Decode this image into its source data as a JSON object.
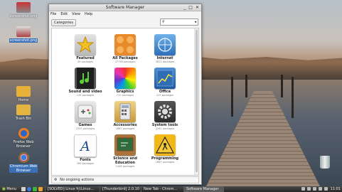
{
  "window": {
    "title": "Software Manager",
    "controls": [
      "_",
      "□",
      "✕"
    ]
  },
  "menubar": [
    "File",
    "Edit",
    "View",
    "Help"
  ],
  "toolbar": {
    "categories_label": "Categories",
    "search_placeholder": ""
  },
  "categories": [
    {
      "name": "Featured",
      "count": "45 packages",
      "icon": "star-icon"
    },
    {
      "name": "All Packages",
      "count": "47738 packages",
      "icon": "all-packages-icon"
    },
    {
      "name": "Internet",
      "count": "3811 packages",
      "icon": "globe-icon"
    },
    {
      "name": "Sound and video",
      "count": "135 packages",
      "icon": "music-note-icon"
    },
    {
      "name": "Graphics",
      "count": "713 packages",
      "icon": "color-wheel-icon"
    },
    {
      "name": "Office",
      "count": "229 packages",
      "icon": "chart-icon"
    },
    {
      "name": "Games",
      "count": "2253 packages",
      "icon": "gamepad-icon"
    },
    {
      "name": "Accessories",
      "count": "1863 packages",
      "icon": "calculator-icon"
    },
    {
      "name": "System tools",
      "count": "2161 packages",
      "icon": "gear-icon"
    },
    {
      "name": "Fonts",
      "count": "289 packages",
      "icon": "font-icon"
    },
    {
      "name": "Science and Education",
      "count": "1446 packages",
      "icon": "chalkboard-icon"
    },
    {
      "name": "Programming",
      "count": "1883 packages",
      "icon": "construction-icon"
    }
  ],
  "status": {
    "text": "No ongoing actions"
  },
  "desktop_icons": [
    {
      "label": "screenshot.png"
    },
    {
      "label": "screenshot.png",
      "selected": true
    },
    {
      "label": "Home"
    },
    {
      "label": "Trash Bin"
    },
    {
      "label": "Firefox Web Browser"
    },
    {
      "label": "Chromium Web Browser",
      "selected": true
    }
  ],
  "taskbar": {
    "menu_label": "Menu",
    "tasks": [
      "[SOLVED] Linux Mi...",
      "Linux...",
      "[Thunderbird] 2.0.10",
      "New Tab - Chrom...",
      "Software Manager"
    ],
    "active_task": 4,
    "clock": "11:01"
  }
}
